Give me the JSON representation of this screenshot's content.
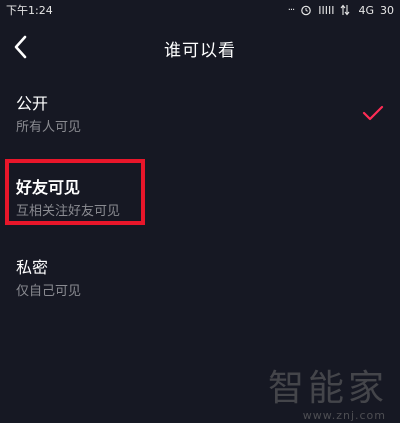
{
  "status_bar": {
    "time": "下午1:24",
    "dots": "···",
    "signal_bars": "IIIII",
    "network": "4G",
    "battery": "30"
  },
  "header": {
    "title": "谁可以看"
  },
  "options": [
    {
      "title": "公开",
      "description": "所有人可见",
      "selected": true
    },
    {
      "title": "好友可见",
      "description": "互相关注好友可见",
      "selected": false
    },
    {
      "title": "私密",
      "description": "仅自己可见",
      "selected": false
    }
  ],
  "icons": {
    "back": "chevron-left-icon",
    "check": "check-icon",
    "alarm": "alarm-clock-icon",
    "data": "data-arrows-icon"
  },
  "colors": {
    "background": "#161823",
    "check": "#fe2c55",
    "highlight": "#e8162a",
    "secondary_text": "#8a8b91"
  },
  "watermark": {
    "logo": "智能家",
    "url": "www.znj.com"
  }
}
